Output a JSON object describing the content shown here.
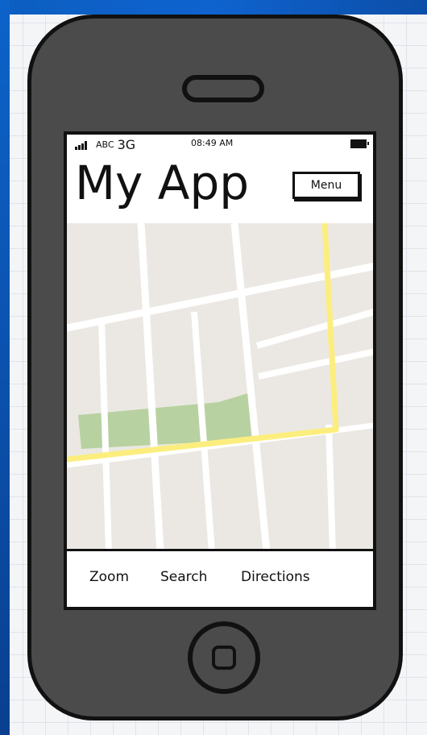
{
  "status_bar": {
    "carrier": "ABC",
    "network": "3G",
    "time": "08:49 AM"
  },
  "app": {
    "title": "My App",
    "menu_label": "Menu"
  },
  "toolbar": {
    "items": [
      "Zoom",
      "Search",
      "Directions"
    ]
  },
  "colors": {
    "map_background": "#ebe8e3",
    "road": "#ffffff",
    "highlight_road": "#fcee7e",
    "park": "#b8d1a0",
    "phone_body": "#4b4b4b"
  }
}
